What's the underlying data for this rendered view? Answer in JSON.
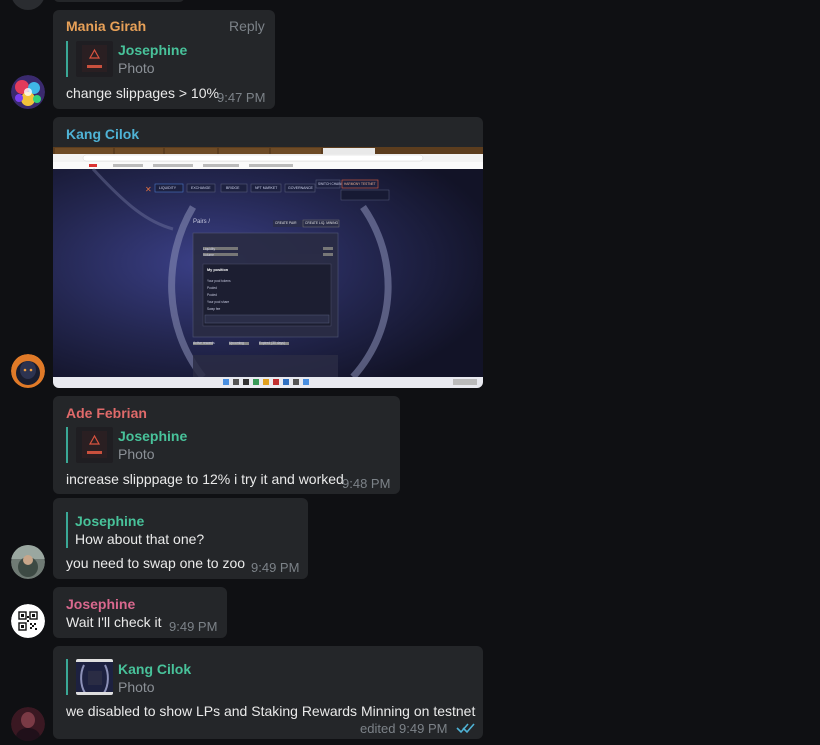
{
  "messages": [
    {
      "sender": "Mania Girah",
      "reply_label": "Reply",
      "quote_name": "Josephine",
      "quote_sub": "Photo",
      "text": "change slippages > 10%",
      "time": "9:47 PM"
    },
    {
      "sender": "Kang Cilok",
      "screenshot": {
        "nav_items": [
          "LIQUIDITY",
          "EXCHANGE",
          "BRIDGE",
          "NFT MARKET",
          "GOVERNANCE"
        ],
        "wallet_button": "SWITCH CHAIN",
        "network_button": "HARMONY TESTNET",
        "pairs_label": "Pairs /",
        "create_pair": "CREATE PAIR",
        "create_lm": "CREATE LIQ. MINING",
        "panel_rows": [
          "Liquidity",
          "Volume"
        ],
        "position_title": "My position",
        "position_rows": [
          "Your pool tokens",
          "Pooled",
          "Pooled",
          "Your pool share",
          "Swap fee"
        ],
        "tabs": [
          "Active rewards",
          "Upcoming",
          "Expired (30 days)"
        ]
      }
    },
    {
      "sender": "Ade Febrian",
      "quote_name": "Josephine",
      "quote_sub": "Photo",
      "text": "increase slipppage to 12% i try it and worked",
      "time": "9:48 PM"
    },
    {
      "sender": "",
      "quote_name": "Josephine",
      "quote_text": "How about that one?",
      "text": "you need to swap one to zoo",
      "time": "9:49 PM"
    },
    {
      "sender": "Josephine",
      "text": "Wait I'll check it",
      "time": "9:49 PM"
    },
    {
      "sender": "",
      "quote_name": "Kang Cilok",
      "quote_sub": "Photo",
      "text": "we disabled to show LPs and Staking Rewards Minning on testnet",
      "time": "edited 9:49 PM"
    }
  ],
  "colors": {
    "background": "#0f1013",
    "bubble": "#242629",
    "sender_mania": "#e8a158",
    "sender_kang": "#4fb3d6",
    "sender_ade": "#e06a6a",
    "sender_josephine": "#d9688e",
    "quote_name": "#48c29a",
    "read_check": "#4fb3d6"
  }
}
